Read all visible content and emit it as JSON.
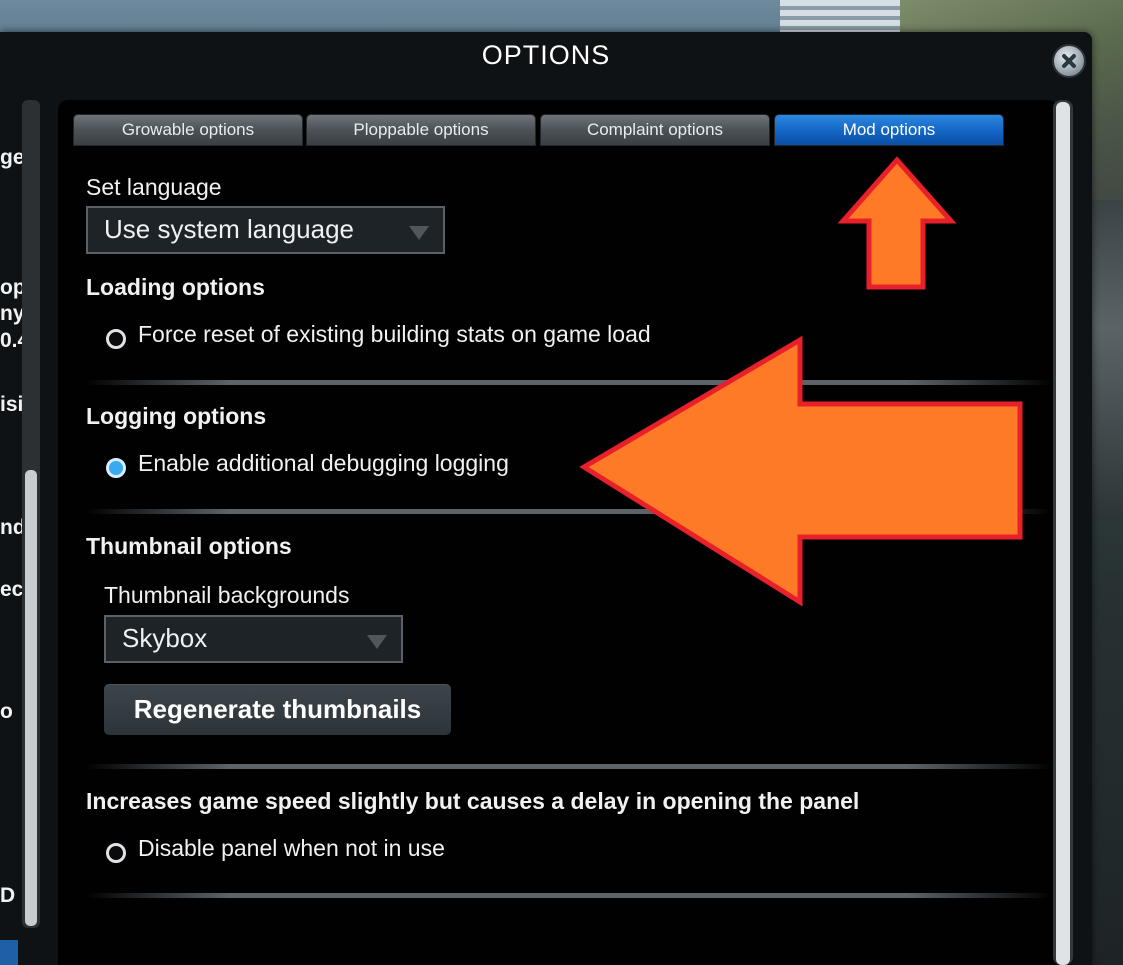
{
  "window": {
    "title": "OPTIONS"
  },
  "left_fragments": [
    "ge",
    "op",
    "ny",
    "0.4",
    "isi",
    "nd",
    "ec",
    "o",
    "D E"
  ],
  "tabs": [
    {
      "label": "Growable options"
    },
    {
      "label": "Ploppable options"
    },
    {
      "label": "Complaint options"
    },
    {
      "label": "Mod options"
    }
  ],
  "language": {
    "label": "Set language",
    "value": "Use system language"
  },
  "loading": {
    "title": "Loading options",
    "option": "Force reset of existing building stats on game load"
  },
  "logging": {
    "title": "Logging options",
    "option": "Enable additional debugging logging"
  },
  "thumbnails": {
    "title": "Thumbnail options",
    "backgrounds_label": "Thumbnail backgrounds",
    "backgrounds_value": "Skybox",
    "regenerate_label": "Regenerate thumbnails"
  },
  "panel_option": {
    "description": "Increases game speed slightly but causes a delay in opening the panel",
    "option": "Disable panel when not in use"
  },
  "colors": {
    "accent": "#1c6fd1",
    "arrow_fill": "#ff7a26",
    "arrow_stroke": "#e8202a",
    "radio_on": "#39a9f0"
  }
}
